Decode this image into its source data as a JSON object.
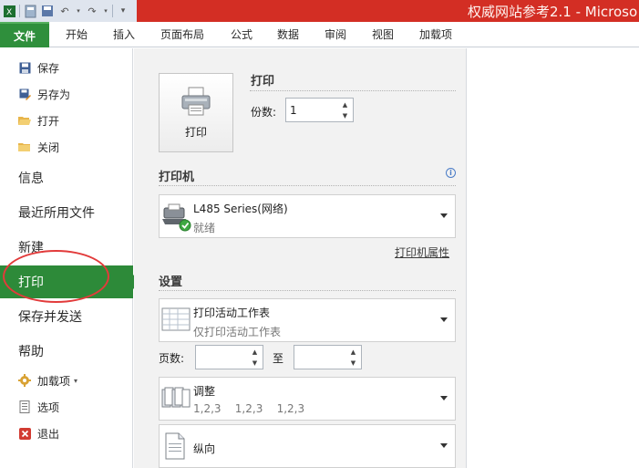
{
  "window": {
    "title": "权威网站参考2.1 - Microso"
  },
  "ribbon": {
    "tabs": [
      "文件",
      "开始",
      "插入",
      "页面布局",
      "公式",
      "数据",
      "审阅",
      "视图",
      "加载项"
    ]
  },
  "nav": {
    "save": "保存",
    "save_as": "另存为",
    "open": "打开",
    "close": "关闭",
    "info": "信息",
    "recent": "最近所用文件",
    "new": "新建",
    "print": "打印",
    "save_send": "保存并发送",
    "help": "帮助",
    "addins": "加载项",
    "options": "选项",
    "exit": "退出"
  },
  "print_panel": {
    "section_title": "打印",
    "print_button": "打印",
    "copies_label": "份数:",
    "copies_value": "1"
  },
  "printer": {
    "section_title": "打印机",
    "name": "L485 Series(网络)",
    "status": "就绪",
    "properties_link": "打印机属性"
  },
  "settings": {
    "section_title": "设置",
    "scope_title": "打印活动工作表",
    "scope_desc": "仅打印活动工作表",
    "pages_label": "页数:",
    "to_label": "至",
    "collate_title": "调整",
    "collate_desc": "1,2,3    1,2,3    1,2,3",
    "orientation": "纵向"
  },
  "colors": {
    "file_tab": "#2f8f3c",
    "active_nav": "#2d8a39",
    "title_bar": "#d32e24",
    "highlight_ring": "#e23b3b"
  }
}
